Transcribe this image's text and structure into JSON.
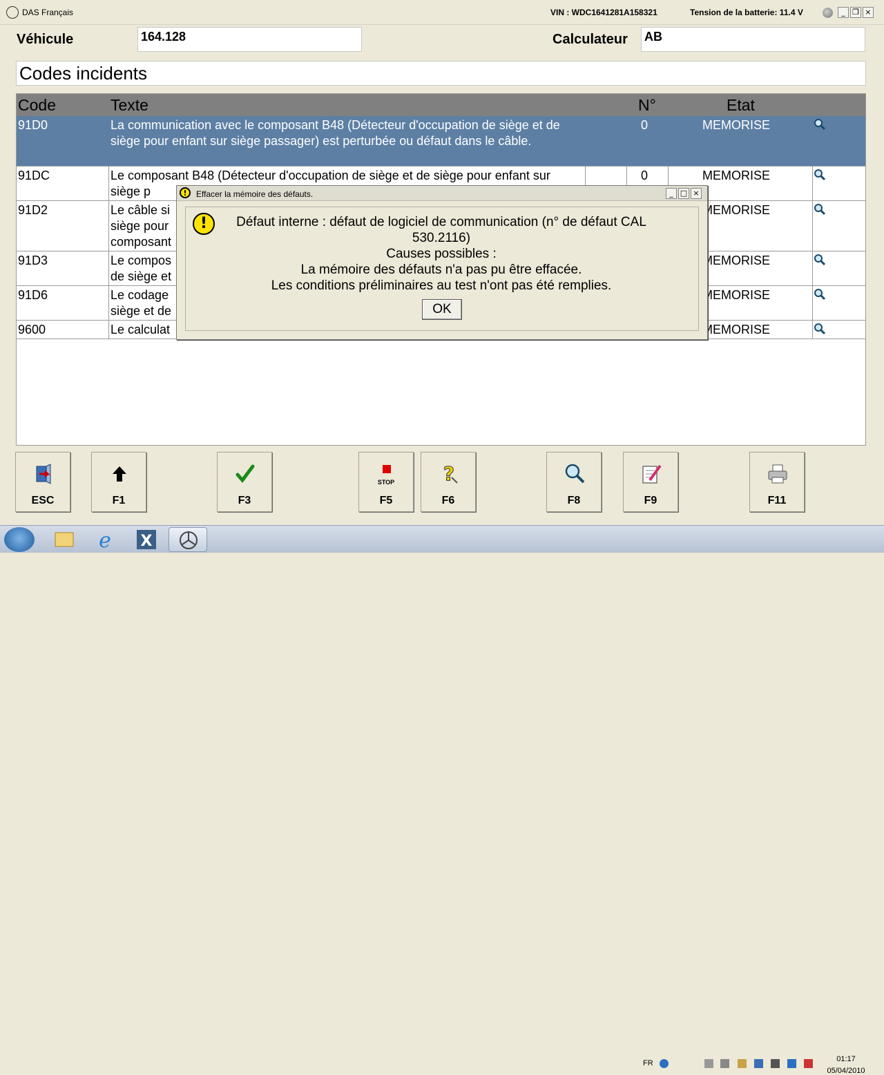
{
  "window": {
    "title": "DAS Français",
    "vin": "VIN : WDC1641281A158321",
    "battery": "Tension de la batterie: 11.4 V"
  },
  "header": {
    "vehicle_label": "Véhicule",
    "vehicle_value": "164.128",
    "ecu_label": "Calculateur",
    "ecu_value": "AB",
    "section_title": "Codes incidents"
  },
  "table": {
    "columns": [
      "Code",
      "Texte",
      "N°",
      "Etat"
    ],
    "rows": [
      {
        "code": "91D0",
        "text": "La communication avec le composant B48 (Détecteur d'occupation de siège et de siège pour enfant sur siège passager) est perturbée ou défaut dans le câble.",
        "n": "0",
        "state": "MEMORISE"
      },
      {
        "code": "91DC",
        "text": "Le composant B48 (Détecteur d'occupation de siège et de siège pour enfant sur siège p",
        "n": "0",
        "state": "MEMORISE"
      },
      {
        "code": "91D2",
        "text_1": "Le câble si",
        "text_2": "siège pour",
        "text_3": "composant",
        "state": "MEMORISE"
      },
      {
        "code": "91D3",
        "text_1": "Le compos",
        "text_2": "de siège et",
        "state": "MEMORISE"
      },
      {
        "code": "91D6",
        "text_1": "Le codage",
        "text_2": "siège et de",
        "state": "MEMORISE"
      },
      {
        "code": "9600",
        "text_1": "Le calculat",
        "state": "MEMORISE"
      }
    ]
  },
  "dialog": {
    "title": "Effacer la mémoire des défauts.",
    "line1": "Défaut interne : défaut de logiciel de communication (n° de défaut CAL",
    "line2": "530.2116)",
    "line3": "Causes possibles :",
    "line4": "La mémoire des défauts n'a pas pu être effacée.",
    "line5": "Les conditions préliminaires au test n'ont pas été remplies.",
    "ok": "OK"
  },
  "fkeys": [
    {
      "label": "ESC",
      "icon": "exit-door-icon"
    },
    {
      "label": "F1",
      "icon": "arrow-up-icon"
    },
    {
      "label": "F3",
      "icon": "checkmark-icon"
    },
    {
      "label": "F5",
      "icon": "stop-icon",
      "icon_text": "STOP"
    },
    {
      "label": "F6",
      "icon": "help-icon"
    },
    {
      "label": "F8",
      "icon": "magnifier-icon"
    },
    {
      "label": "F9",
      "icon": "edit-document-icon"
    },
    {
      "label": "F11",
      "icon": "printer-icon"
    }
  ],
  "taskbar": {
    "lang": "FR",
    "time": "01:17",
    "date": "05/04/2010"
  },
  "colors": {
    "selected_row": "#5d7fa4",
    "table_header": "#808080",
    "warning": "#ffe400"
  }
}
